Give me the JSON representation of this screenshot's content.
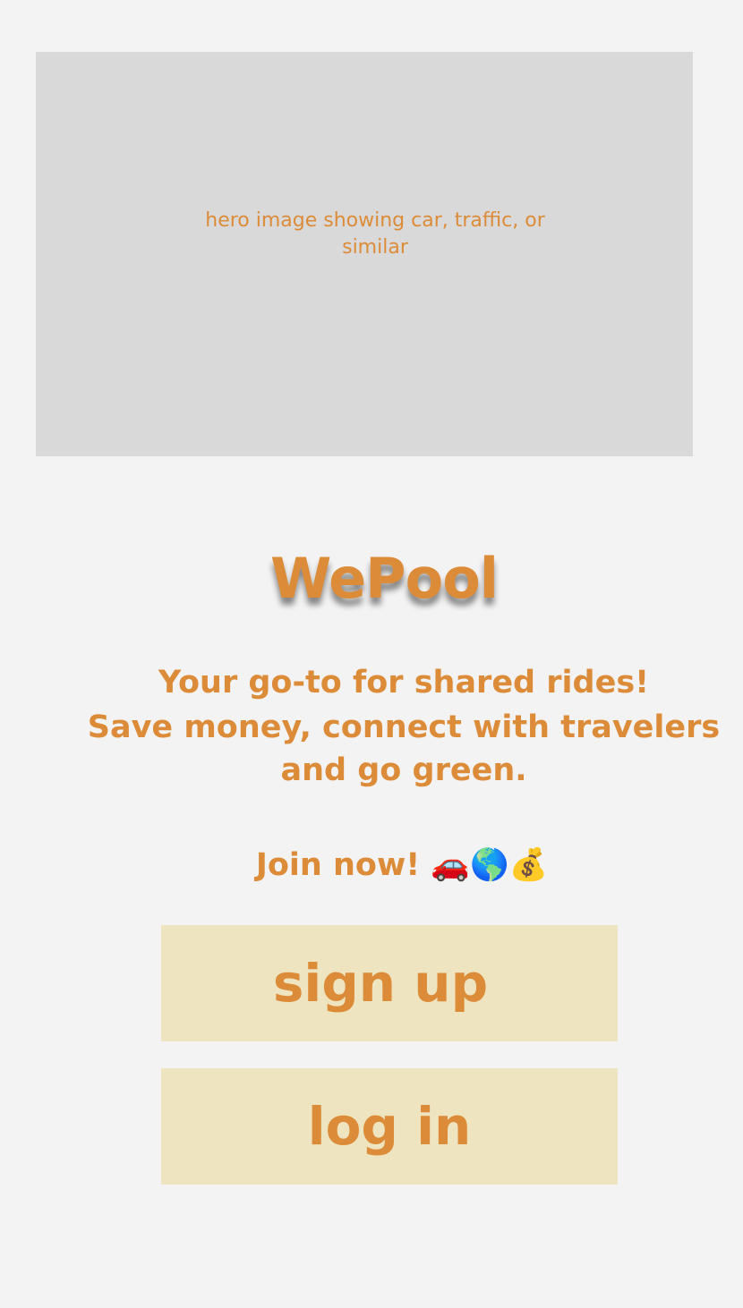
{
  "hero": {
    "caption": "hero image showing car, traffic, or similar"
  },
  "brand": {
    "name": "WePool"
  },
  "tagline": {
    "line1": "Your go-to for shared rides!",
    "line2": "Save money, connect with travelers",
    "line3": "and go green."
  },
  "cta": {
    "text": "Join now! 🚗🌎💰"
  },
  "buttons": {
    "signup_label": "sign up",
    "login_label": "log in"
  },
  "colors": {
    "background": "#f4f3f4",
    "accent": "#dc8c38",
    "placeholder": "#d9d9d9",
    "button_bg": "#efe4c0"
  }
}
